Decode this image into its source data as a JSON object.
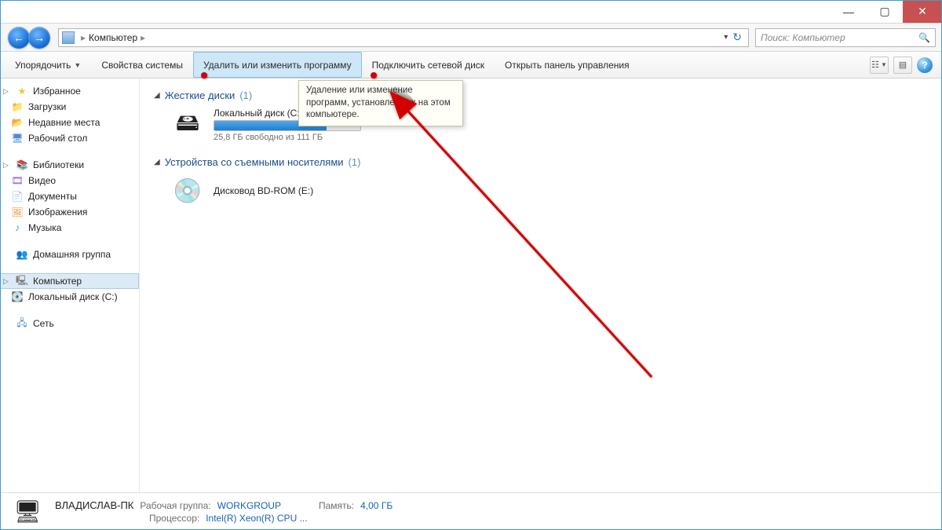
{
  "window": {
    "minimize": "—",
    "maximize": "▢",
    "close": "✕"
  },
  "address": {
    "root": "Компьютер",
    "search_placeholder": "Поиск: Компьютер"
  },
  "toolbar": {
    "organize": "Упорядочить",
    "system_props": "Свойства системы",
    "uninstall": "Удалить или изменить программу",
    "map_drive": "Подключить сетевой диск",
    "control_panel": "Открыть панель управления"
  },
  "tooltip": {
    "text": "Удаление или изменение программ, установленных на этом компьютере."
  },
  "sidebar": {
    "favorites": "Избранное",
    "downloads": "Загрузки",
    "recent": "Недавние места",
    "desktop": "Рабочий стол",
    "libraries": "Библиотеки",
    "video": "Видео",
    "documents": "Документы",
    "pictures": "Изображения",
    "music": "Музыка",
    "homegroup": "Домашняя группа",
    "computer": "Компьютер",
    "local_c": "Локальный диск (C:)",
    "network": "Сеть"
  },
  "content": {
    "hdd_group": "Жесткие диски",
    "hdd_count": "(1)",
    "drive_c": {
      "name": "Локальный диск (C:)",
      "free": "25,8 ГБ свободно из 111 ГБ"
    },
    "removable_group": "Устройства со съемными носителями",
    "removable_count": "(1)",
    "bd_rom": "Дисковод BD-ROM (E:)"
  },
  "status": {
    "pcname": "ВЛАДИСЛАВ-ПК",
    "workgroup_label": "Рабочая группа:",
    "workgroup_value": "WORKGROUP",
    "memory_label": "Память:",
    "memory_value": "4,00 ГБ",
    "cpu_label": "Процессор:",
    "cpu_value": "Intel(R) Xeon(R) CPU    ..."
  }
}
